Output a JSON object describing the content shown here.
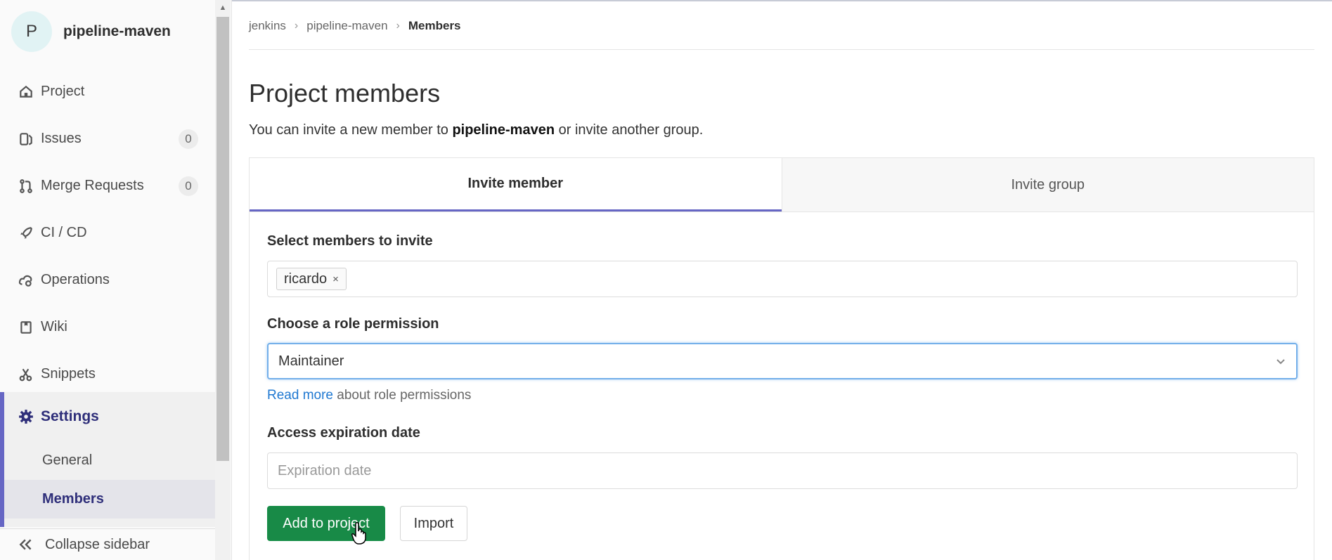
{
  "sidebar": {
    "project_avatar_letter": "P",
    "project_name": "pipeline-maven",
    "items": [
      {
        "label": "Project",
        "icon": "home-icon"
      },
      {
        "label": "Issues",
        "icon": "issues-icon",
        "badge": "0"
      },
      {
        "label": "Merge Requests",
        "icon": "merge-request-icon",
        "badge": "0"
      },
      {
        "label": "CI / CD",
        "icon": "rocket-icon"
      },
      {
        "label": "Operations",
        "icon": "cloud-gear-icon"
      },
      {
        "label": "Wiki",
        "icon": "book-icon"
      },
      {
        "label": "Snippets",
        "icon": "scissors-icon"
      }
    ],
    "settings": {
      "label": "Settings",
      "icon": "gear-icon",
      "sub_items": [
        "General",
        "Members"
      ]
    },
    "collapse_label": "Collapse sidebar"
  },
  "breadcrumb": {
    "items": [
      "jenkins",
      "pipeline-maven",
      "Members"
    ]
  },
  "main": {
    "title": "Project members",
    "intro_before": "You can invite a new member to ",
    "intro_project": "pipeline-maven",
    "intro_after": " or invite another group.",
    "tabs": [
      {
        "label": "Invite member",
        "active": true
      },
      {
        "label": "Invite group",
        "active": false
      }
    ],
    "form": {
      "members_label": "Select members to invite",
      "member_token": "ricardo",
      "member_token_remove": "×",
      "role_label": "Choose a role permission",
      "role_value": "Maintainer",
      "help_link": "Read more",
      "help_text": " about role permissions",
      "expiry_label": "Access expiration date",
      "expiry_placeholder": "Expiration date",
      "submit_label": "Add to project",
      "import_label": "Import"
    }
  },
  "colors": {
    "accent": "#6666c4",
    "submit_button": "#188a47",
    "link": "#1f78d1",
    "focus_border": "#73afea"
  }
}
